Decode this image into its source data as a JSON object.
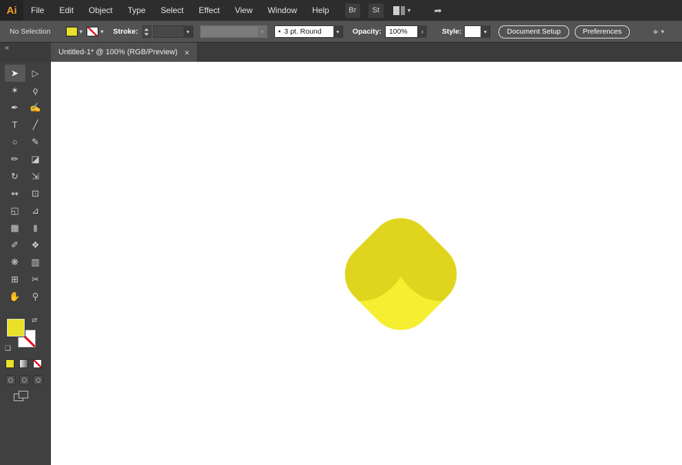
{
  "app": {
    "logo_text": "Ai"
  },
  "menubar": {
    "items": [
      "File",
      "Edit",
      "Object",
      "Type",
      "Select",
      "Effect",
      "View",
      "Window",
      "Help"
    ],
    "bridge_badge": "Br",
    "stock_badge": "St"
  },
  "controlbar": {
    "selection_status": "No Selection",
    "stroke_label": "Stroke:",
    "stroke_weight_value": "",
    "brush_value": "",
    "variable_width_bullet": "•",
    "variable_width_value": "3 pt. Round",
    "opacity_label": "Opacity:",
    "opacity_value": "100%",
    "style_label": "Style:",
    "style_value": "",
    "document_setup_button": "Document Setup",
    "preferences_button": "Preferences"
  },
  "tabbar": {
    "collapse_glyph": "«",
    "tab_title": "Untitled-1* @ 100% (RGB/Preview)",
    "close_glyph": "×"
  },
  "toolbar": {
    "tools": [
      {
        "name": "selection-tool",
        "glyph": "➤",
        "selected": true
      },
      {
        "name": "direct-selection-tool",
        "glyph": "▷"
      },
      {
        "name": "magic-wand-tool",
        "glyph": "✶"
      },
      {
        "name": "lasso-tool",
        "glyph": "ϙ"
      },
      {
        "name": "pen-tool",
        "glyph": "✒"
      },
      {
        "name": "curvature-tool",
        "glyph": "✍"
      },
      {
        "name": "type-tool",
        "glyph": "T"
      },
      {
        "name": "line-segment-tool",
        "glyph": "╱"
      },
      {
        "name": "ellipse-tool",
        "glyph": "○"
      },
      {
        "name": "paintbrush-tool",
        "glyph": "✎"
      },
      {
        "name": "pencil-tool",
        "glyph": "✏"
      },
      {
        "name": "eraser-tool",
        "glyph": "◪"
      },
      {
        "name": "rotate-tool",
        "glyph": "↻"
      },
      {
        "name": "scale-tool",
        "glyph": "⇲"
      },
      {
        "name": "width-tool",
        "glyph": "↭"
      },
      {
        "name": "free-transform-tool",
        "glyph": "⊡"
      },
      {
        "name": "shape-builder-tool",
        "glyph": "◱"
      },
      {
        "name": "perspective-grid-tool",
        "glyph": "⊿"
      },
      {
        "name": "mesh-tool",
        "glyph": "▦"
      },
      {
        "name": "gradient-tool",
        "glyph": "▮"
      },
      {
        "name": "eyedropper-tool",
        "glyph": "✐"
      },
      {
        "name": "blend-tool",
        "glyph": "❖"
      },
      {
        "name": "symbol-sprayer-tool",
        "glyph": "❋"
      },
      {
        "name": "column-graph-tool",
        "glyph": "▥"
      },
      {
        "name": "artboard-tool",
        "glyph": "⊞"
      },
      {
        "name": "slice-tool",
        "glyph": "✂"
      },
      {
        "name": "hand-tool",
        "glyph": "✋"
      },
      {
        "name": "zoom-tool",
        "glyph": "⚲"
      }
    ]
  },
  "colors": {
    "fill_swatch": "#e8e029",
    "none_red": "#e0131b",
    "logo_orange": "#f0a030"
  },
  "icons": {
    "chevron_down": "▾",
    "chevron_right": "›",
    "swap": "⇄",
    "mini_default": "❑",
    "align": "⌖",
    "share": "➦"
  },
  "canvas": {
    "background": "#ffffff",
    "shape": {
      "name": "rounded-diamond",
      "top_color": "#e0d51e",
      "bottom_color": "#f6ee30"
    }
  }
}
